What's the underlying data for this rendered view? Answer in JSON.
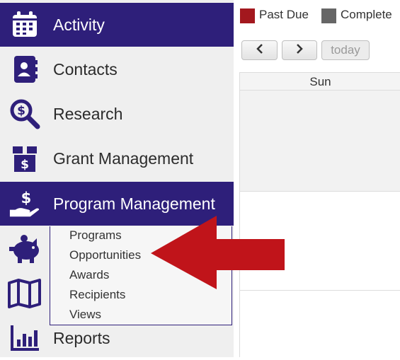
{
  "sidebar": {
    "items": [
      {
        "label": "Activity",
        "icon": "calendar-icon"
      },
      {
        "label": "Contacts",
        "icon": "contacts-book-icon"
      },
      {
        "label": "Research",
        "icon": "magnifier-dollar-icon"
      },
      {
        "label": "Grant Management",
        "icon": "box-dollar-icon"
      },
      {
        "label": "Program Management",
        "icon": "hand-dollar-icon"
      },
      {
        "label": "Reports",
        "icon": "bar-chart-icon"
      }
    ],
    "submenu": [
      "Programs",
      "Opportunities",
      "Awards",
      "Recipients",
      "Views"
    ],
    "extra_icons": [
      "piggy-bank-icon",
      "map-icon"
    ]
  },
  "legend": [
    {
      "label": "Past Due",
      "color": "#a3181e"
    },
    {
      "label": "Complete",
      "color": "#666666"
    }
  ],
  "toolbar": {
    "prev": "‹",
    "next": "›",
    "today": "today"
  },
  "calendar": {
    "day_header": "Sun"
  },
  "colors": {
    "accent": "#2e1f7a",
    "arrow": "#c0141a"
  }
}
